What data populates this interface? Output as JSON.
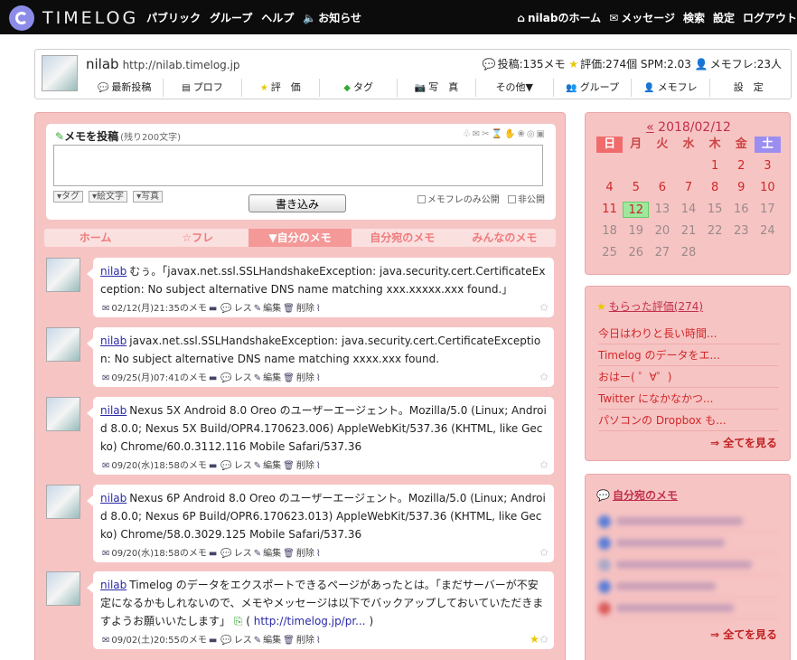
{
  "topbar": {
    "logo_text": "TIMELOG",
    "nav": [
      "パブリック",
      "グループ",
      "ヘルプ",
      "お知らせ"
    ],
    "right": [
      "nilabのホーム",
      "メッセージ",
      "検索",
      "設定",
      "ログアウト"
    ]
  },
  "profile": {
    "name": "nilab",
    "url": "http://nilab.timelog.jp",
    "stats": "投稿:135メモ ★ 評価:274個 SPM:2.03 メモフレ:23人",
    "stats_posts": "投稿:135メモ",
    "stats_eval": "評価:274個",
    "stats_spm": "SPM:2.03",
    "stats_friends": "メモフレ:23人",
    "tabs": [
      "最新投稿",
      "プロフ",
      "評　価",
      "タグ",
      "写　真",
      "その他▼",
      "グループ",
      "メモフレ",
      "設　定"
    ]
  },
  "post": {
    "title": "メモを投稿",
    "remaining": "(残り200文字)",
    "textarea_placeholder": "",
    "opts": [
      "▾タグ",
      "▾絵文字",
      "▾写真"
    ],
    "submit": "書き込み",
    "check_friends": "メモフレのみ公開",
    "check_private": "非公開"
  },
  "tabs": [
    "ホーム",
    "☆フレ",
    "▼自分のメモ",
    "自分宛のメモ",
    "みんなのメモ"
  ],
  "active_tab": 2,
  "memos": [
    {
      "user": "nilab",
      "text": "むぅ。「javax.net.ssl.SSLHandshakeException: java.security.cert.CertificateException: No subject alternative DNS name matching xxx.xxxxx.xxx found.」",
      "date": "02/12(月)21:35のメモ",
      "reply": "レス",
      "edit": "編集",
      "delete": "削除"
    },
    {
      "user": "nilab",
      "text": "javax.net.ssl.SSLHandshakeException: java.security.cert.CertificateException: No subject alternative DNS name matching xxxx.xxx found.",
      "date": "09/25(月)07:41のメモ",
      "reply": "レス",
      "edit": "編集",
      "delete": "削除"
    },
    {
      "user": "nilab",
      "text": "Nexus 5X Android 8.0 Oreo のユーザーエージェント。Mozilla/5.0 (Linux; Android 8.0.0; Nexus 5X Build/OPR4.170623.006) AppleWebKit/537.36 (KHTML, like Gecko) Chrome/60.0.3112.116 Mobile Safari/537.36",
      "date": "09/20(水)18:58のメモ",
      "reply": "レス",
      "edit": "編集",
      "delete": "削除"
    },
    {
      "user": "nilab",
      "text": "Nexus 6P Android 8.0 Oreo のユーザーエージェント。Mozilla/5.0 (Linux; Android 8.0.0; Nexus 6P Build/OPR6.170623.013) AppleWebKit/537.36 (KHTML, like Gecko) Chrome/58.0.3029.125 Mobile Safari/537.36",
      "date": "09/20(水)18:58のメモ",
      "reply": "レス",
      "edit": "編集",
      "delete": "削除"
    },
    {
      "user": "nilab",
      "text": "Timelog のデータをエクスポートできるページがあったとは。「まだサーバーが不安定になるかもしれないので、メモやメッセージは以下でバックアップしておいていただきますようお願いいたします」",
      "link_pre": " ( ",
      "link": "http://timelog.jp/pr...",
      "link_post": " )",
      "date": "09/02(土)20:55のメモ",
      "reply": "レス",
      "edit": "編集",
      "delete": "削除"
    }
  ],
  "calendar": {
    "title": "2018/02/12",
    "prev": "«",
    "weekdays": [
      "日",
      "月",
      "火",
      "水",
      "木",
      "金",
      "土"
    ],
    "lead_blanks": 4,
    "days": 28,
    "today": 12
  },
  "evaluations": {
    "title": "もらった評価(274)",
    "items": [
      "今日はわりと長い時間...",
      "Timelog のデータをエ...",
      "おはー( ゜∀゜)",
      "Twitter になかなかつ...",
      "パソコンの Dropbox も..."
    ],
    "more": "⇒ 全てを見る"
  },
  "to_me": {
    "title": "自分宛のメモ",
    "more": "⇒ 全てを見る"
  }
}
